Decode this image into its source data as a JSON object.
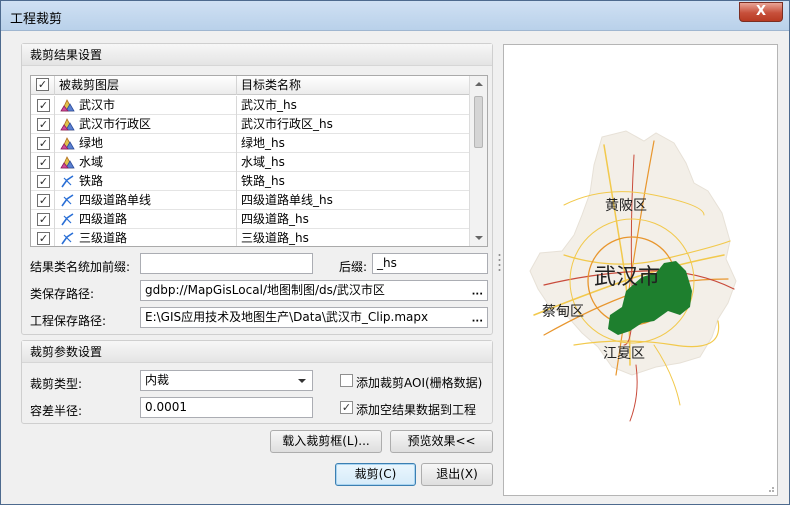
{
  "window": {
    "title": "工程裁剪",
    "close_label": "X"
  },
  "clip_result_group": {
    "title": "裁剪结果设置",
    "table": {
      "headers": [
        "被裁剪图层",
        "目标类名称"
      ],
      "rows": [
        {
          "layer": "武汉市",
          "target": "武汉市_hs",
          "icon": "region-layer-icon"
        },
        {
          "layer": "武汉市行政区",
          "target": "武汉市行政区_hs",
          "icon": "region-layer-icon"
        },
        {
          "layer": "绿地",
          "target": "绿地_hs",
          "icon": "region-layer-icon"
        },
        {
          "layer": "水域",
          "target": "水域_hs",
          "icon": "region-layer-icon"
        },
        {
          "layer": "铁路",
          "target": "铁路_hs",
          "icon": "line-layer-icon"
        },
        {
          "layer": "四级道路单线",
          "target": "四级道路单线_hs",
          "icon": "line-layer-icon"
        },
        {
          "layer": "四级道路",
          "target": "四级道路_hs",
          "icon": "line-layer-icon"
        },
        {
          "layer": "三级道路",
          "target": "三级道路_hs",
          "icon": "line-layer-icon"
        }
      ]
    },
    "prefix_label": "结果类名统加前缀:",
    "prefix_value": "",
    "suffix_label": "后缀:",
    "suffix_value": "_hs",
    "class_path_label": "类保存路径:",
    "class_path_value": "gdbp://MapGisLocal/地图制图/ds/武汉市区",
    "project_path_label": "工程保存路径:",
    "project_path_value": "E:\\GIS应用技术及地图生产\\Data\\武汉市_Clip.mapx",
    "browse_label": "···"
  },
  "clip_param_group": {
    "title": "裁剪参数设置",
    "type_label": "裁剪类型:",
    "type_value": "内裁",
    "tolerance_label": "容差半径:",
    "tolerance_value": "0.0001",
    "add_aoi_label": "添加裁剪AOI(栅格数据)",
    "add_aoi_checked": false,
    "add_empty_label": "添加空结果数据到工程",
    "add_empty_checked": true
  },
  "buttons": {
    "load_clip_frame": "载入裁剪框(L)...",
    "preview": "预览效果<<",
    "clip": "裁剪(C)",
    "exit": "退出(X)"
  },
  "map_preview": {
    "city_label": "武汉市",
    "district_labels": [
      "黄陂区",
      "蔡甸区",
      "江夏区"
    ]
  },
  "colors": {
    "region_fill": "#f3efe8",
    "greenland": "#1e7f2e",
    "road_yellow": "#f2c94c",
    "road_orange": "#e8962e",
    "road_red": "#c94b3b"
  }
}
